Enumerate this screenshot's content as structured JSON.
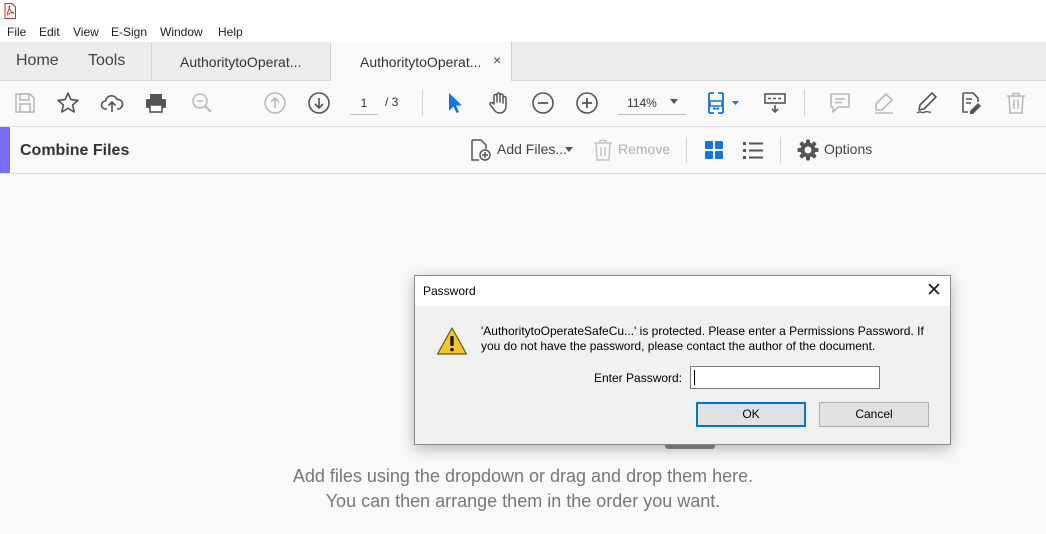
{
  "menu": [
    "File",
    "Edit",
    "View",
    "E-Sign",
    "Window",
    "Help"
  ],
  "tabs": {
    "home": "Home",
    "tools": "Tools",
    "doc1": "AuthoritytoOperat...",
    "doc2": "AuthoritytoOperat...",
    "close_glyph": "×"
  },
  "toolbar": {
    "current_page": "1",
    "total_pages": "/ 3",
    "zoom": "114%"
  },
  "combine": {
    "title": "Combine Files",
    "add_files": "Add Files...",
    "remove": "Remove",
    "options": "Options"
  },
  "drop_zone": {
    "line1": "Add files using the dropdown or drag and drop them here.",
    "line2": "You can then arrange them in the order you want."
  },
  "dialog": {
    "title": "Password",
    "close_glyph": "✕",
    "message": "'AuthoritytoOperateSafeCu...' is protected. Please enter a Permissions Password. If you do not have the password, please contact the author of the document.",
    "password_label": "Enter Password:",
    "password_value": "",
    "ok": "OK",
    "cancel": "Cancel"
  },
  "colors": {
    "accent": "#7b6cf6",
    "active_blue": "#1473e6",
    "dialog_focus": "#0078d7",
    "disabled_icon": "#b9b9b9"
  },
  "icons": [
    "app-pdf-icon",
    "save-icon",
    "star-icon",
    "upload-cloud-icon",
    "print-icon",
    "zoom-search-icon",
    "page-up-icon",
    "page-down-icon",
    "select-cursor-icon",
    "hand-icon",
    "zoom-out-icon",
    "zoom-in-icon",
    "fit-page-icon",
    "scroll-mode-icon",
    "comment-icon",
    "highlight-icon",
    "sign-icon",
    "edit-pdf-icon",
    "trash-icon",
    "add-file-icon",
    "remove-trash-icon",
    "grid-view-icon",
    "list-view-icon",
    "gear-icon",
    "warning-icon"
  ]
}
